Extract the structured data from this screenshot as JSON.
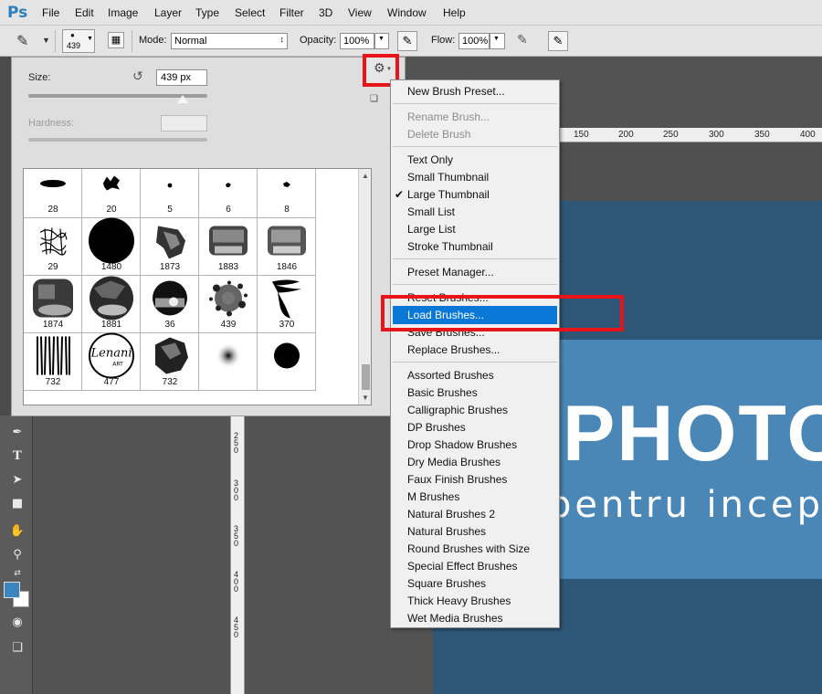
{
  "app": {
    "logo": "Ps"
  },
  "menubar": {
    "items": [
      "File",
      "Edit",
      "Image",
      "Layer",
      "Type",
      "Select",
      "Filter",
      "3D",
      "View",
      "Window",
      "Help"
    ]
  },
  "options": {
    "brush_size": "439",
    "mode_label": "Mode:",
    "mode_value": "Normal",
    "opacity_label": "Opacity:",
    "opacity_value": "100%",
    "flow_label": "Flow:",
    "flow_value": "100%"
  },
  "picker": {
    "size_label": "Size:",
    "size_value": "439 px",
    "hardness_label": "Hardness:",
    "size_slider_fraction": 0.86,
    "brushes": [
      "28",
      "20",
      "5",
      "6",
      "8",
      "29",
      "1480",
      "1873",
      "1883",
      "1846",
      "1874",
      "1881",
      "36",
      "439",
      "370",
      "732",
      "477",
      "732",
      "",
      ""
    ]
  },
  "menu": {
    "new_preset": "New Brush Preset...",
    "rename": "Rename Brush...",
    "delete": "Delete Brush",
    "views": [
      "Text Only",
      "Small Thumbnail",
      "Large Thumbnail",
      "Small List",
      "Large List",
      "Stroke Thumbnail"
    ],
    "checked_view": "Large Thumbnail",
    "preset_manager": "Preset Manager...",
    "reset": "Reset Brushes...",
    "load": "Load Brushes...",
    "save": "Save Brushes...",
    "replace": "Replace Brushes...",
    "libraries": [
      "Assorted Brushes",
      "Basic Brushes",
      "Calligraphic Brushes",
      "DP Brushes",
      "Drop Shadow Brushes",
      "Dry Media Brushes",
      "Faux Finish Brushes",
      "M Brushes",
      "Natural Brushes 2",
      "Natural Brushes",
      "Round Brushes with Size",
      "Special Effect Brushes",
      "Square Brushes",
      "Thick Heavy Brushes",
      "Wet Media Brushes"
    ]
  },
  "ruler": {
    "h_labels": [
      "150",
      "200",
      "250",
      "300",
      "350",
      "400"
    ],
    "v_labels": [
      "250",
      "300",
      "350",
      "400",
      "450"
    ]
  },
  "canvas": {
    "title": "PHOTOS",
    "subtitle": "pentru incep"
  },
  "colors": {
    "accent": "#0a78d7",
    "highlight_box": "#e8141a",
    "foreground": "#3a85c0"
  }
}
